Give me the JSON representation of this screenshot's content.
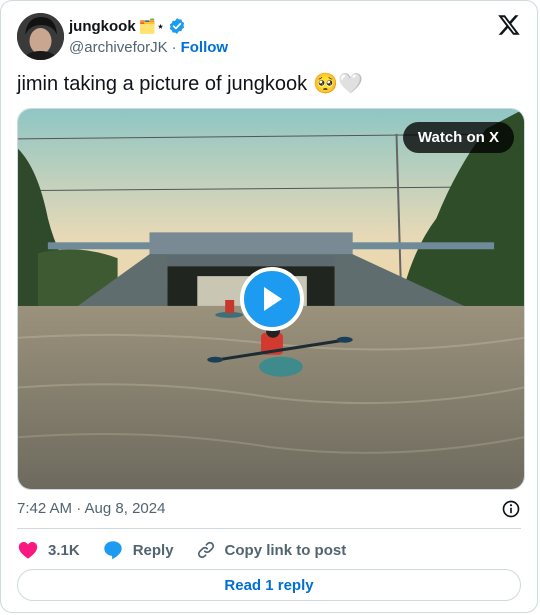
{
  "author": {
    "display_name": "jungkook",
    "emojis_after_name": "🗂️⋆",
    "handle": "@archiveforJK",
    "separator": "·",
    "follow_label": "Follow"
  },
  "tweet": {
    "text": "jimin taking a picture of jungkook",
    "emojis": "🥺🤍"
  },
  "media": {
    "watch_label": "Watch on X"
  },
  "meta": {
    "timestamp": "7:42 AM · Aug 8, 2024"
  },
  "actions": {
    "likes": "3.1K",
    "reply_label": "Reply",
    "copy_label": "Copy link to post"
  },
  "read_reply_label": "Read 1 reply",
  "colors": {
    "accent": "#1d9bf0",
    "link": "#006fd6",
    "like": "#f91880",
    "muted": "#536471",
    "border": "#cfd9de"
  },
  "icons": [
    "x-logo-icon",
    "verified-badge-icon",
    "play-icon",
    "info-icon",
    "heart-icon",
    "reply-bubble-icon",
    "link-icon"
  ]
}
